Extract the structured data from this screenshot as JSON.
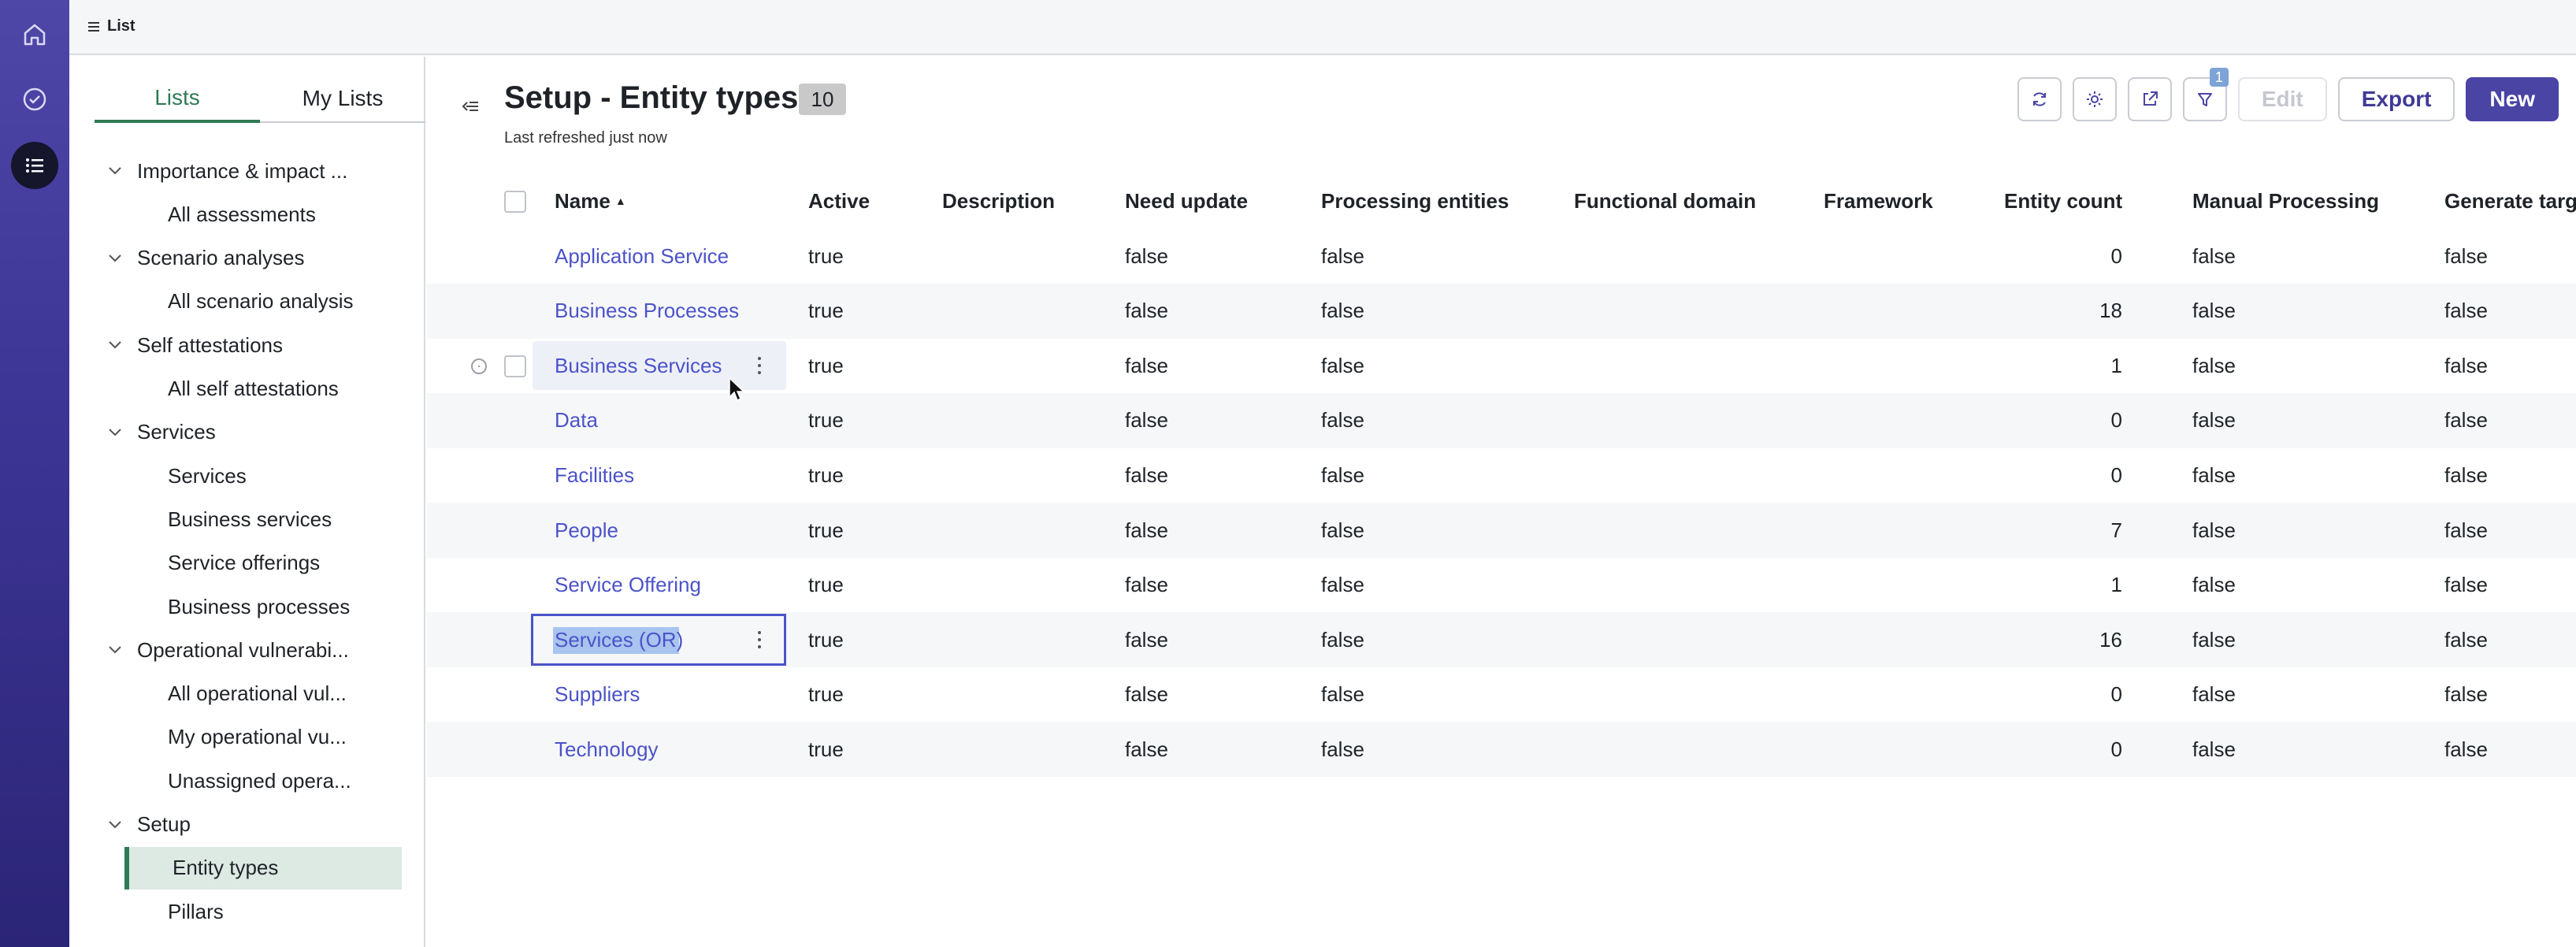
{
  "topbar": {
    "crumb": "List"
  },
  "sidebar": {
    "tabs": [
      {
        "label": "Lists",
        "active": true
      },
      {
        "label": "My Lists",
        "active": false
      }
    ],
    "tree": [
      {
        "label": "Importance & impact ...",
        "type": "group"
      },
      {
        "label": "All assessments",
        "type": "child"
      },
      {
        "label": "Scenario analyses",
        "type": "group"
      },
      {
        "label": "All scenario analysis",
        "type": "child"
      },
      {
        "label": "Self attestations",
        "type": "group"
      },
      {
        "label": "All self attestations",
        "type": "child"
      },
      {
        "label": "Services",
        "type": "group"
      },
      {
        "label": "Services",
        "type": "child"
      },
      {
        "label": "Business services",
        "type": "child"
      },
      {
        "label": "Service offerings",
        "type": "child"
      },
      {
        "label": "Business processes",
        "type": "child"
      },
      {
        "label": "Operational vulnerabi...",
        "type": "group"
      },
      {
        "label": "All operational vul...",
        "type": "child"
      },
      {
        "label": "My operational vu...",
        "type": "child"
      },
      {
        "label": "Unassigned opera...",
        "type": "child"
      },
      {
        "label": "Setup",
        "type": "group"
      },
      {
        "label": "Entity types",
        "type": "child",
        "selected": true
      },
      {
        "label": "Pillars",
        "type": "child"
      }
    ]
  },
  "main": {
    "title": "Setup - Entity types",
    "count": "10",
    "refreshed": "Last refreshed just now",
    "toolbar": {
      "filter_count": "1",
      "edit_label": "Edit",
      "export_label": "Export",
      "new_label": "New"
    },
    "columns": [
      "Name",
      "Active",
      "Description",
      "Need update",
      "Processing entities",
      "Functional domain",
      "Framework",
      "Entity count",
      "Manual Processing",
      "Generate targ"
    ],
    "sort_indicator": "▲",
    "rows": [
      {
        "name": "Application Service",
        "active": "true",
        "description": "",
        "need_update": "false",
        "processing": "false",
        "functional_domain": "",
        "framework": "",
        "entity_count": "0",
        "manual": "false",
        "generate": "false"
      },
      {
        "name": "Business Processes",
        "active": "true",
        "description": "",
        "need_update": "false",
        "processing": "false",
        "functional_domain": "",
        "framework": "",
        "entity_count": "18",
        "manual": "false",
        "generate": "false"
      },
      {
        "name": "Business Services",
        "active": "true",
        "description": "",
        "need_update": "false",
        "processing": "false",
        "functional_domain": "",
        "framework": "",
        "entity_count": "1",
        "manual": "false",
        "generate": "false"
      },
      {
        "name": "Data",
        "active": "true",
        "description": "",
        "need_update": "false",
        "processing": "false",
        "functional_domain": "",
        "framework": "",
        "entity_count": "0",
        "manual": "false",
        "generate": "false"
      },
      {
        "name": "Facilities",
        "active": "true",
        "description": "",
        "need_update": "false",
        "processing": "false",
        "functional_domain": "",
        "framework": "",
        "entity_count": "0",
        "manual": "false",
        "generate": "false"
      },
      {
        "name": "People",
        "active": "true",
        "description": "",
        "need_update": "false",
        "processing": "false",
        "functional_domain": "",
        "framework": "",
        "entity_count": "7",
        "manual": "false",
        "generate": "false"
      },
      {
        "name": "Service Offering",
        "active": "true",
        "description": "",
        "need_update": "false",
        "processing": "false",
        "functional_domain": "",
        "framework": "",
        "entity_count": "1",
        "manual": "false",
        "generate": "false"
      },
      {
        "name": "Services (OR)",
        "active": "true",
        "description": "",
        "need_update": "false",
        "processing": "false",
        "functional_domain": "",
        "framework": "",
        "entity_count": "16",
        "manual": "false",
        "generate": "false"
      },
      {
        "name": "Suppliers",
        "active": "true",
        "description": "",
        "need_update": "false",
        "processing": "false",
        "functional_domain": "",
        "framework": "",
        "entity_count": "0",
        "manual": "false",
        "generate": "false"
      },
      {
        "name": "Technology",
        "active": "true",
        "description": "",
        "need_update": "false",
        "processing": "false",
        "functional_domain": "",
        "framework": "",
        "entity_count": "0",
        "manual": "false",
        "generate": "false"
      }
    ]
  },
  "colors": {
    "accent": "#4a44a5",
    "link": "#4b53c9",
    "selected_green": "#2f7a54"
  }
}
